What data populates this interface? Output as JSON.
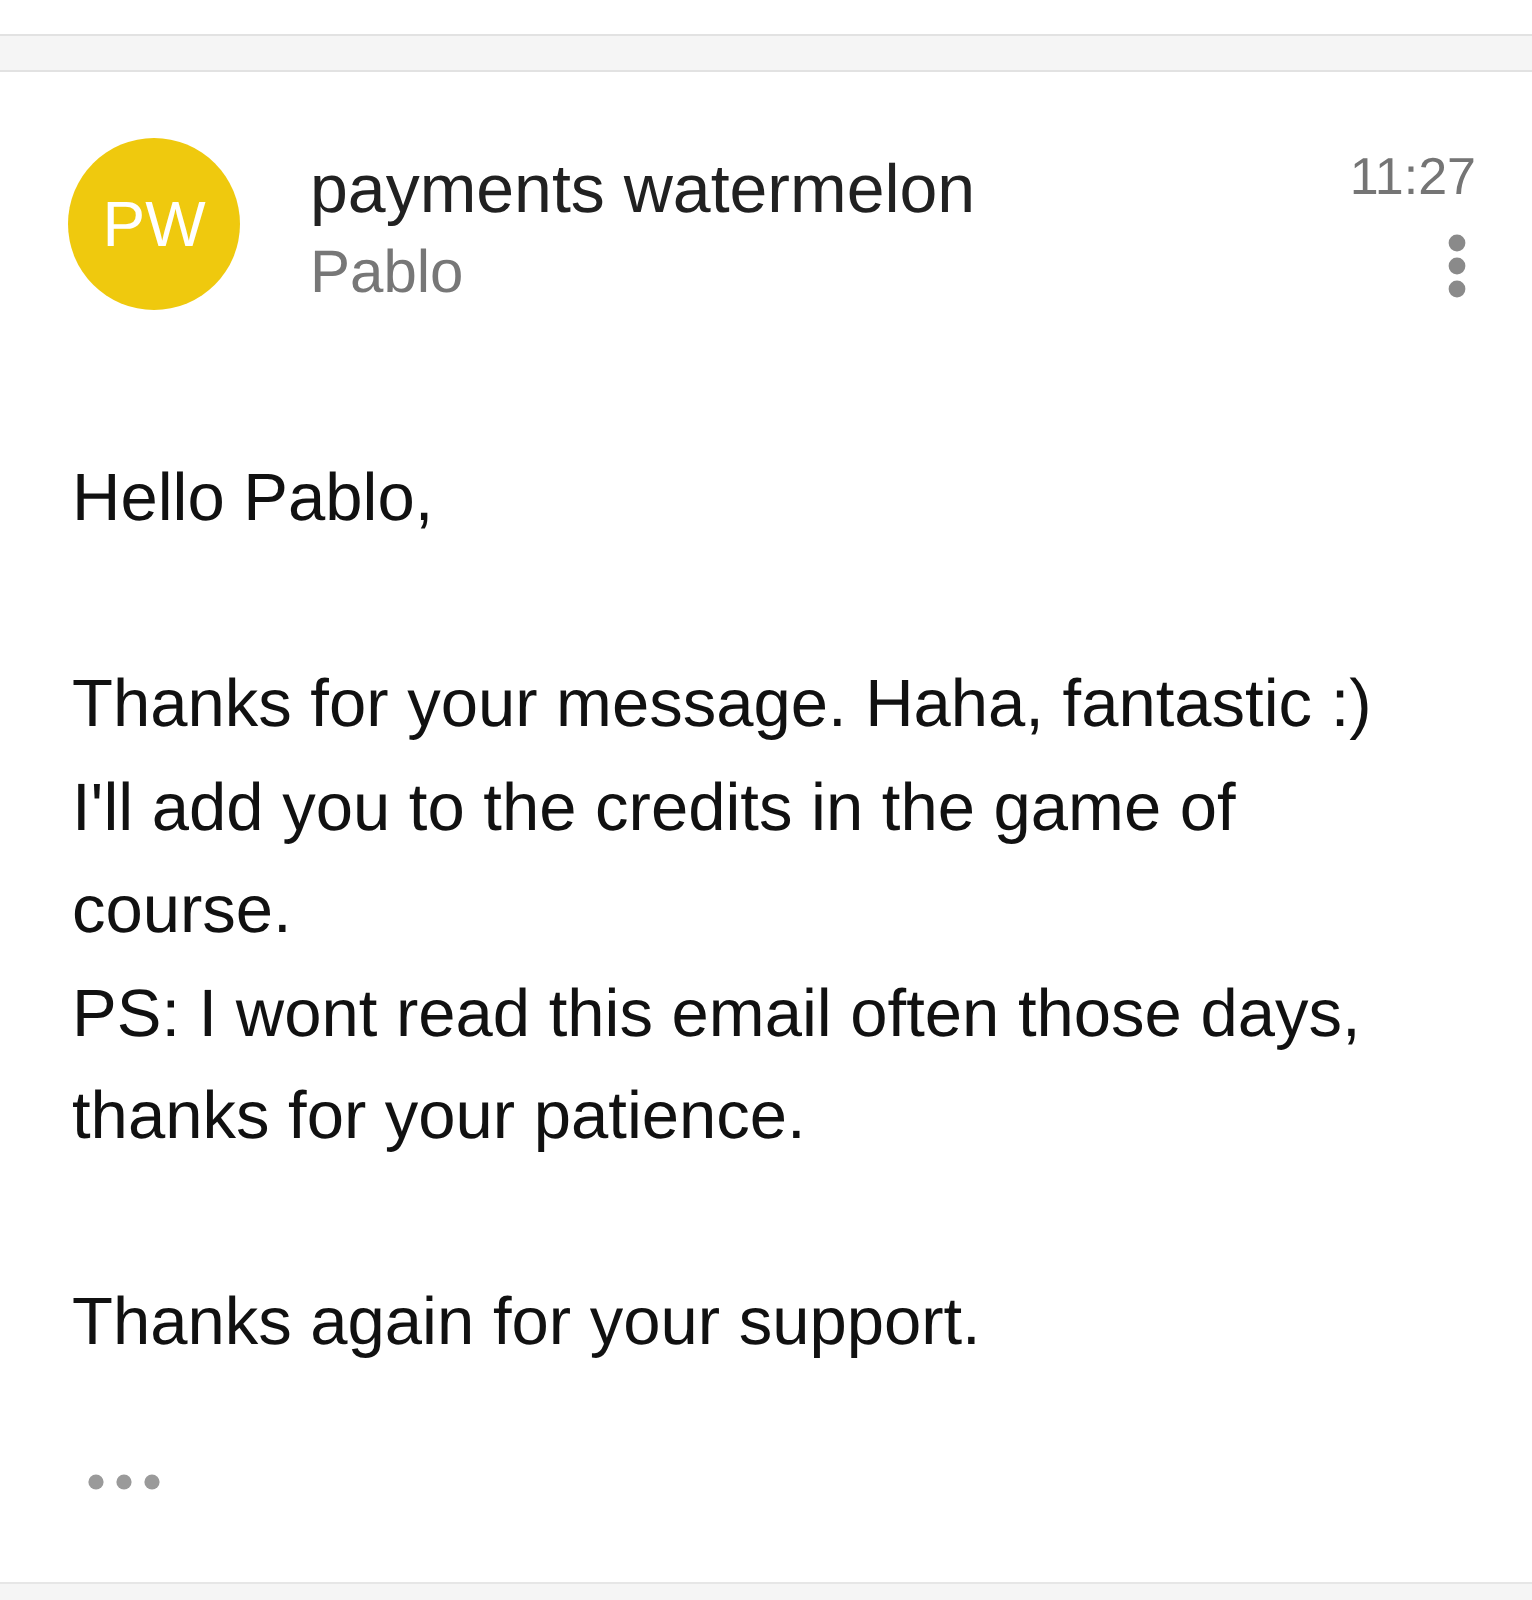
{
  "message": {
    "avatar_initials": "PW",
    "sender": "payments watermelon",
    "recipient": "Pablo",
    "time": "11:27"
  },
  "body": {
    "paragraphs": [
      [
        "Hello Pablo,"
      ],
      [
        "Thanks for your message. Haha, fantastic :)",
        "I'll add you to the credits in the game of",
        "course.",
        "PS: I wont read this email often those days,",
        "thanks for your patience."
      ],
      [
        "Thanks again for your support."
      ]
    ]
  }
}
